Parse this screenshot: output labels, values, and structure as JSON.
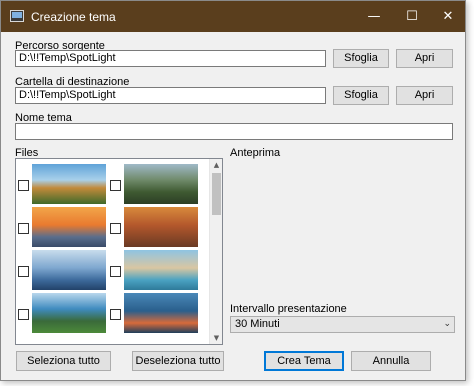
{
  "window": {
    "title": "Creazione tema",
    "minimize_glyph": "—",
    "maximize_glyph": "☐",
    "close_glyph": "✕"
  },
  "source": {
    "label": "Percorso sorgente",
    "value": "D:\\!!Temp\\SpotLight",
    "browse_label": "Sfoglia",
    "open_label": "Apri"
  },
  "destination": {
    "label": "Cartella di destinazione",
    "value": "D:\\!!Temp\\SpotLight",
    "browse_label": "Sfoglia",
    "open_label": "Apri"
  },
  "theme_name": {
    "label": "Nome tema",
    "value": ""
  },
  "files": {
    "label": "Files",
    "scroll_up_glyph": "▲",
    "scroll_down_glyph": "▼",
    "items": [
      {
        "checked": false,
        "icon": "landscape-thumbnail-autumn-hills"
      },
      {
        "checked": false,
        "icon": "landscape-thumbnail-mountain-road"
      },
      {
        "checked": false,
        "icon": "landscape-thumbnail-sunset-rock"
      },
      {
        "checked": false,
        "icon": "landscape-thumbnail-canyon"
      },
      {
        "checked": false,
        "icon": "landscape-thumbnail-lighthouse"
      },
      {
        "checked": false,
        "icon": "landscape-thumbnail-beach"
      },
      {
        "checked": false,
        "icon": "landscape-thumbnail-crater-lake"
      },
      {
        "checked": false,
        "icon": "landscape-thumbnail-coast"
      }
    ]
  },
  "preview": {
    "label": "Anteprima"
  },
  "interval": {
    "label": "Intervallo presentazione",
    "selected": "30 Minuti",
    "chevron_glyph": "⌄"
  },
  "actions": {
    "select_all": "Seleziona tutto",
    "deselect_all": "Deseleziona tutto",
    "create": "Crea Tema",
    "cancel": "Annulla"
  },
  "colors": {
    "titlebar": "#5a3e1d",
    "window_bg": "#f0f0f0",
    "accent": "#0078d7"
  }
}
